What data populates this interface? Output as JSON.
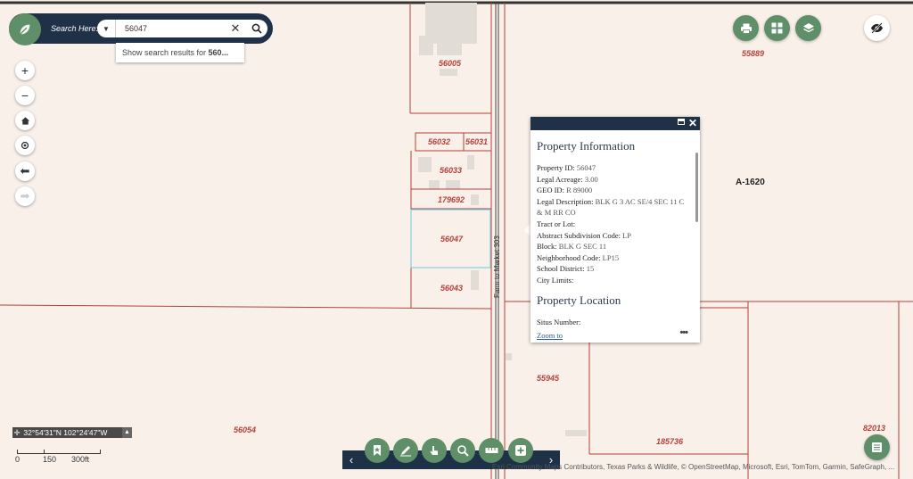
{
  "search": {
    "label": "Search Here:",
    "value": "56047",
    "suggestion_prefix": "Show search results for ",
    "suggestion_term": "560..."
  },
  "parcels": {
    "p56005": "56005",
    "p55889": "55889",
    "p56032": "56032",
    "p56031": "56031",
    "p56033": "56033",
    "p179692": "179692",
    "p56047": "56047",
    "p56043": "56043",
    "p55945": "55945",
    "p56054": "56054",
    "p185736": "185736",
    "p82013": "82013",
    "abstract": "A-1620",
    "road": "Farm to Market 303"
  },
  "popup": {
    "title": "Property Information",
    "fields": [
      {
        "key": "Property ID:",
        "value": "56047"
      },
      {
        "key": "Legal Acreage:",
        "value": "3.00"
      },
      {
        "key": "GEO ID:",
        "value": "R 89000"
      },
      {
        "key": "Legal Description:",
        "value": "BLK G 3 AC SE/4 SEC 11 C & M RR CO"
      },
      {
        "key": "Tract or Lot:",
        "value": ""
      },
      {
        "key": "Abstract Subdivision Code:",
        "value": "LP"
      },
      {
        "key": "Block:",
        "value": "BLK G SEC 11"
      },
      {
        "key": "Neighborhood Code:",
        "value": "LP15"
      },
      {
        "key": "School District:",
        "value": "15"
      },
      {
        "key": "City Limits:",
        "value": ""
      }
    ],
    "section2_title": "Property Location",
    "section2_first": "Situs Number:",
    "zoom_link": "Zoom to",
    "more": "•••"
  },
  "coords": {
    "text": "32°54'31\"N 102°24'47\"W"
  },
  "scale": {
    "zero": "0",
    "mid": "150",
    "end": "300ft"
  },
  "attribution": "Esri Community Maps Contributors, Texas Parks & Wildlife, © OpenStreetMap, Microsoft, Esri, TomTom, Garmin, SafeGraph, ...",
  "colors": {
    "navy": "#1f3146",
    "green": "#5e8f68",
    "parcel_line": "#b4413a",
    "map_bg": "#faf0ea"
  }
}
